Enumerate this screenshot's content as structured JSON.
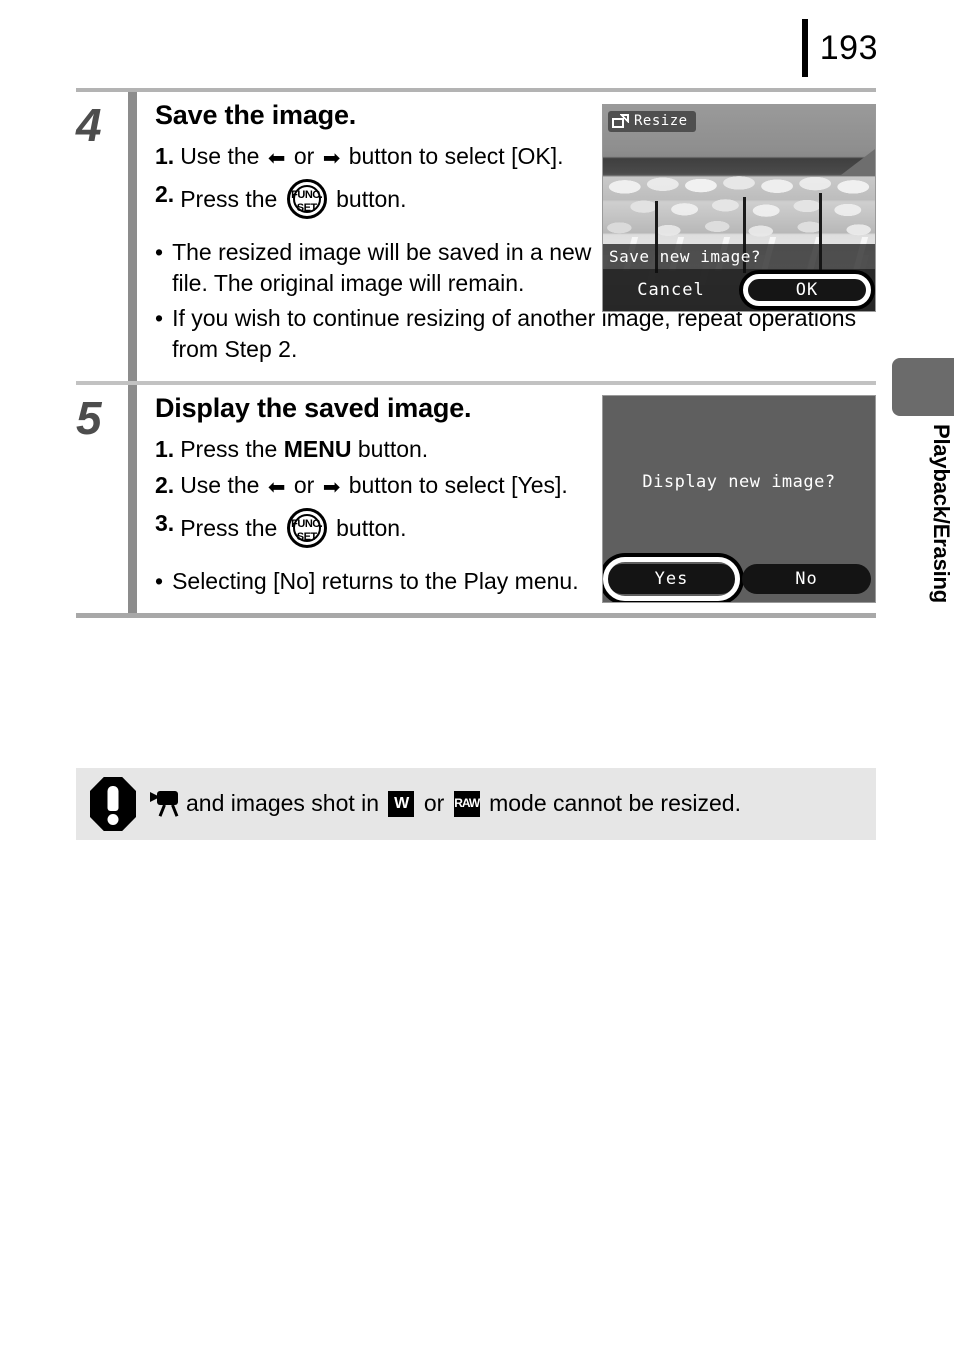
{
  "page": {
    "number": "193",
    "side_tab_label": "Playback/Erasing"
  },
  "steps": [
    {
      "number": "4",
      "title": "Save the image.",
      "instructions": [
        {
          "marker": "1.",
          "before": "Use the",
          "mid": "or",
          "after": "button to select [OK].",
          "icon_left": "arrow-left",
          "icon_right": "arrow-right"
        },
        {
          "marker": "2.",
          "before": "Press the",
          "after": "button.",
          "icon": "func-set-button"
        }
      ],
      "bullets": [
        "The resized image will be saved in a new file. The original image will remain.",
        "If you wish to continue resizing of another image, repeat operations from Step 2."
      ],
      "screen": {
        "tag_label": "Resize",
        "tag_icon": "resize-icon",
        "prompt": "Save new image?",
        "choices": [
          {
            "label": "Cancel",
            "selected": false
          },
          {
            "label": "OK",
            "selected": true
          }
        ]
      }
    },
    {
      "number": "5",
      "title": "Display the saved image.",
      "instructions": [
        {
          "marker": "1.",
          "before": "Press the",
          "strong": "MENU",
          "after": "button."
        },
        {
          "marker": "2.",
          "before": "Use the",
          "mid": "or",
          "after": "button to select [Yes].",
          "icon_left": "arrow-left",
          "icon_right": "arrow-right"
        },
        {
          "marker": "3.",
          "before": "Press the",
          "after": "button.",
          "icon": "func-set-button"
        }
      ],
      "bullets": [
        "Selecting [No] returns to the Play menu."
      ],
      "screen": {
        "message": "Display new image?",
        "choices": [
          {
            "label": "Yes",
            "selected": true
          },
          {
            "label": "No",
            "selected": false
          }
        ]
      }
    }
  ],
  "caution": {
    "icon": "exclamation-icon",
    "movie_icon": "movie-camera-icon",
    "text_before": "and images shot in",
    "mode_1": "W",
    "text_mid": "or",
    "mode_2": "RAW",
    "text_after": "mode cannot be resized."
  },
  "glyphs": {
    "arrow_left": "←",
    "arrow_right": "→",
    "bullet": "•",
    "func_line1": "FUNC.",
    "func_line2": "SET"
  }
}
